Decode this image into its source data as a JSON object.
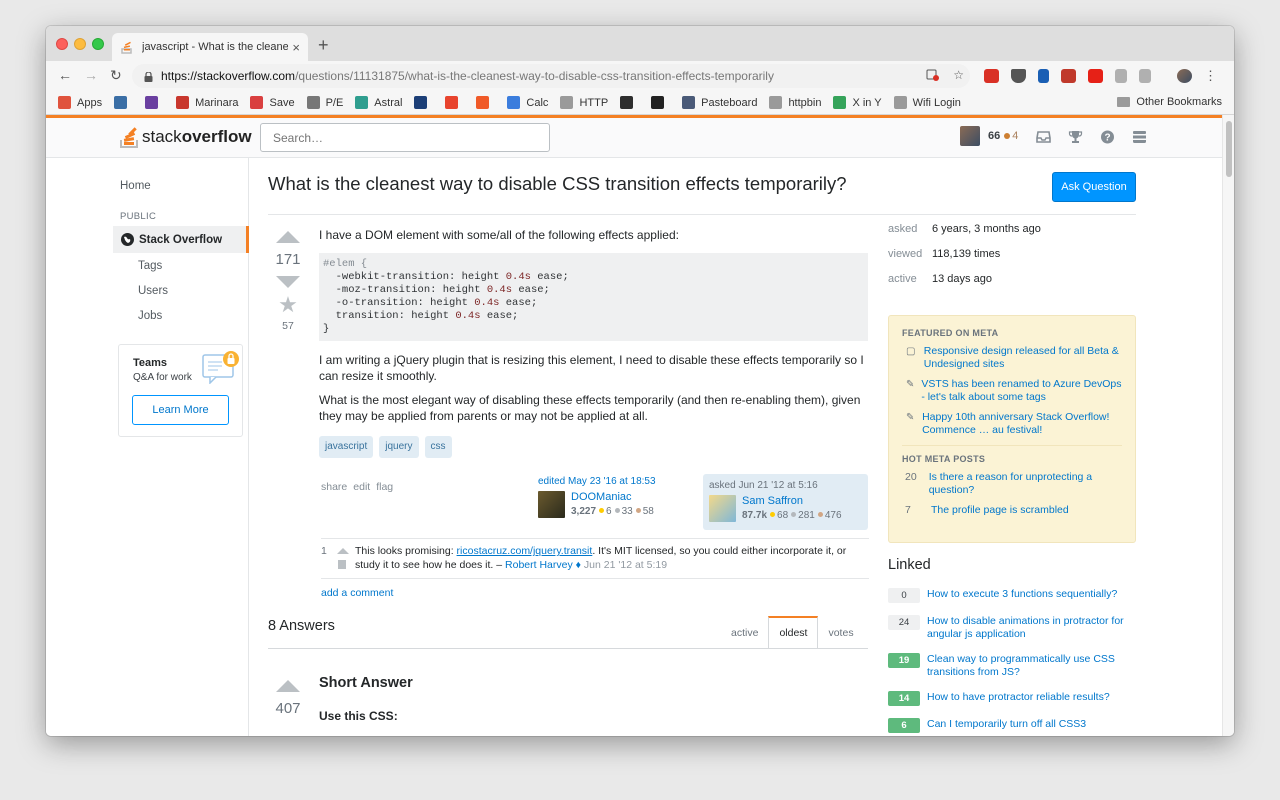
{
  "browser": {
    "tab_title": "javascript - What is the cleanest",
    "tab_close": "×",
    "new_tab": "+",
    "back": "←",
    "forward": "→",
    "reload": "↻",
    "url_host": "https://stackoverflow.com",
    "url_path": "/questions/11131875/what-is-the-cleanest-way-to-disable-css-transition-effects-temporarily",
    "star": "☆",
    "bookmarks": [
      {
        "label": "Apps",
        "color": "#e0533d"
      },
      {
        "label": "",
        "color": "#3a6ea5"
      },
      {
        "label": "",
        "color": "#6a3fa0"
      },
      {
        "label": "Marinara",
        "color": "#c8372d"
      },
      {
        "label": "Save",
        "color": "#d93f3f"
      },
      {
        "label": "P/E",
        "color": "#777777"
      },
      {
        "label": "Astral",
        "color": "#2f9e8f"
      },
      {
        "label": "",
        "color": "#1c3f77"
      },
      {
        "label": "",
        "color": "#e8442e"
      },
      {
        "label": "",
        "color": "#f05a28"
      },
      {
        "label": "Calc",
        "color": "#3b7ddd"
      },
      {
        "label": "HTTP",
        "color": "#9a9a9a"
      },
      {
        "label": "",
        "color": "#2d2d2d"
      },
      {
        "label": "",
        "color": "#222222"
      },
      {
        "label": "Pasteboard",
        "color": "#4a5a78"
      },
      {
        "label": "httpbin",
        "color": "#9a9a9a"
      },
      {
        "label": "X in Y",
        "color": "#35a35a"
      },
      {
        "label": "Wifi Login",
        "color": "#9a9a9a"
      }
    ],
    "other_bookmarks": "Other Bookmarks"
  },
  "so": {
    "logo_plain": "stack",
    "logo_bold": "overflow",
    "search_placeholder": "Search…",
    "user_rep": "66",
    "user_bronze": "4",
    "brand_color": "#f48024",
    "link_color": "#0077cc"
  },
  "nav": {
    "home": "Home",
    "public": "PUBLIC",
    "stackoverflow": "Stack Overflow",
    "tags": "Tags",
    "users": "Users",
    "jobs": "Jobs",
    "teams_title": "Teams",
    "teams_sub": "Q&A for work",
    "teams_btn": "Learn More"
  },
  "question": {
    "title": "What is the cleanest way to disable CSS transition effects temporarily?",
    "ask_button": "Ask Question",
    "votes": "171",
    "favorites": "57",
    "intro": "I have a DOM element with some/all of the following effects applied:",
    "code": {
      "l1_comment": "#elem {",
      "l2_a": "  -webkit-transition: height ",
      "l2_n": "0.4s",
      "l2_b": " ease;",
      "l3_a": "  -moz-transition: height ",
      "l3_n": "0.4s",
      "l3_b": " ease;",
      "l4_a": "  -o-transition: height ",
      "l4_n": "0.4s",
      "l4_b": " ease;",
      "l5_a": "  transition: height ",
      "l5_n": "0.4s",
      "l5_b": " ease;",
      "l6": "}"
    },
    "p2": "I am writing a jQuery plugin that is resizing this element, I need to disable these effects temporarily so I can resize it smoothly.",
    "p3": "What is the most elegant way of disabling these effects temporarily (and then re-enabling them), given they may be applied from parents or may not be applied at all.",
    "tags": [
      "javascript",
      "jquery",
      "css"
    ],
    "actions": [
      "share",
      "edit",
      "flag"
    ],
    "edited": {
      "time": "edited May 23 '16 at 18:53",
      "name": "DOOManiac",
      "rep": "3,227",
      "gold": "6",
      "silver": "33",
      "bronze": "58"
    },
    "asked": {
      "time": "asked Jun 21 '12 at 5:16",
      "name": "Sam Saffron",
      "rep": "87.7k",
      "gold": "68",
      "silver": "281",
      "bronze": "476"
    }
  },
  "comment": {
    "score": "1",
    "text_a": "This looks promising: ",
    "link": "ricostacruz.com/jquery.transit",
    "text_b": ". It's MIT licensed, so you could either incorporate it, or study it to see how he does it. – ",
    "user": "Robert Harvey ♦",
    "date": " Jun 21 '12 at 5:19"
  },
  "add_comment": "add a comment",
  "answers": {
    "count_label": "8 Answers",
    "tabs": [
      "active",
      "oldest",
      "votes"
    ],
    "active_tab": "oldest",
    "first_votes": "407",
    "first_heading": "Short Answer",
    "first_sub": "Use this CSS:"
  },
  "stats": [
    {
      "label": "asked",
      "value": "6 years, 3 months ago"
    },
    {
      "label": "viewed",
      "value": "118,139 times"
    },
    {
      "label": "active",
      "value": "13 days ago"
    }
  ],
  "meta": {
    "featured_head": "FEATURED ON META",
    "featured": [
      "Responsive design released for all Beta & Undesigned sites",
      "VSTS has been renamed to Azure DevOps - let's talk about some tags",
      "Happy 10th anniversary Stack Overflow! Commence … au festival!"
    ],
    "hot_head": "HOT META POSTS",
    "hot": [
      {
        "num": "20",
        "text": "Is there a reason for unprotecting a question?"
      },
      {
        "num": "7",
        "text": "The profile page is scrambled"
      }
    ]
  },
  "linked": {
    "title": "Linked",
    "items": [
      {
        "score": "0",
        "accepted": false,
        "text": "How to execute 3 functions sequentially?"
      },
      {
        "score": "24",
        "accepted": false,
        "text": "How to disable animations in protractor for angular js application"
      },
      {
        "score": "19",
        "accepted": true,
        "text": "Clean way to programmatically use CSS transitions from JS?"
      },
      {
        "score": "14",
        "accepted": true,
        "text": "How to have protractor reliable results?"
      },
      {
        "score": "6",
        "accepted": true,
        "text": "Can I temporarily turn off all CSS3"
      }
    ]
  }
}
